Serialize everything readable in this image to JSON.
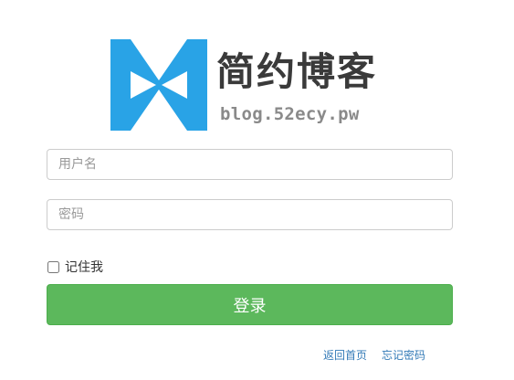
{
  "brand": {
    "name": "简约博客",
    "url": "blog.52ecy.pw",
    "accent_color": "#29a3e6"
  },
  "form": {
    "username": {
      "placeholder": "用户名",
      "value": ""
    },
    "password": {
      "placeholder": "密码",
      "value": ""
    },
    "remember_label": "记住我",
    "remember_checked": false,
    "login_label": "登录",
    "login_color": "#5cb85c"
  },
  "links": {
    "home": "返回首页",
    "forgot": "忘记密码",
    "link_color": "#337ab7"
  }
}
